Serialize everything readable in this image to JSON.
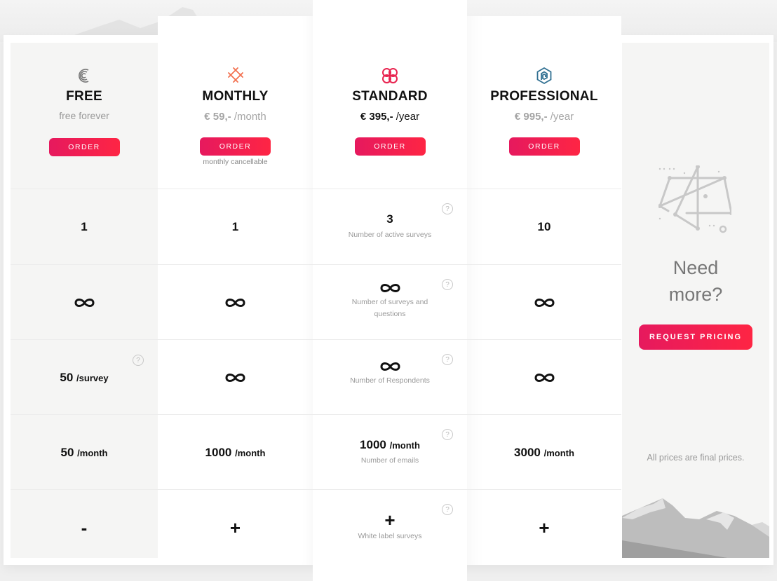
{
  "plans": [
    {
      "id": "free",
      "name": "FREE",
      "subtitle": "free forever",
      "icon": "signal-arcs-icon",
      "order_label": "ORDER",
      "features": [
        {
          "value": "1"
        },
        {
          "value": "∞"
        },
        {
          "value": "50",
          "unit": "/survey",
          "help": "?"
        },
        {
          "value": "50",
          "unit": "/month"
        },
        {
          "value": "-"
        }
      ]
    },
    {
      "id": "monthly",
      "name": "MONTHLY",
      "price_amount": "€ 59,-",
      "price_period": "/month",
      "icon": "cross-pattern-icon",
      "order_label": "ORDER",
      "order_note": "monthly cancellable",
      "features": [
        {
          "value": "1"
        },
        {
          "value": "∞"
        },
        {
          "value": "∞"
        },
        {
          "value": "1000",
          "unit": "/month"
        },
        {
          "value": "+"
        }
      ]
    },
    {
      "id": "standard",
      "name": "STANDARD",
      "price_amount": "€ 395,-",
      "price_period": "/year",
      "icon": "clover-icon",
      "order_label": "ORDER",
      "features": [
        {
          "value": "3",
          "label": "Number of active surveys",
          "help": "?"
        },
        {
          "value": "∞",
          "label": "Number of surveys and questions",
          "help": "?"
        },
        {
          "value": "∞",
          "label": "Number of Respondents",
          "help": "?"
        },
        {
          "value": "1000",
          "unit": "/month",
          "label": "Number of emails",
          "help": "?"
        },
        {
          "value": "+",
          "label": "White label surveys",
          "help": "?"
        }
      ]
    },
    {
      "id": "professional",
      "name": "PROFESSIONAL",
      "price_amount": "€ 995,-",
      "price_period": "/year",
      "icon": "hexagon-spiral-icon",
      "order_label": "ORDER",
      "features": [
        {
          "value": "10"
        },
        {
          "value": "∞"
        },
        {
          "value": "∞"
        },
        {
          "value": "3000",
          "unit": "/month"
        },
        {
          "value": "+"
        }
      ]
    }
  ],
  "more": {
    "heading_line1": "Need",
    "heading_line2": "more?",
    "button_label": "REQUEST PRICING",
    "note": "All prices are final prices."
  },
  "colors": {
    "accent_start": "#e6195e",
    "accent_end": "#fe2544",
    "monthly_icon": "#f2704f",
    "standard_icon": "#e8234f",
    "professional_icon": "#2f6f91",
    "free_icon": "#777777"
  }
}
